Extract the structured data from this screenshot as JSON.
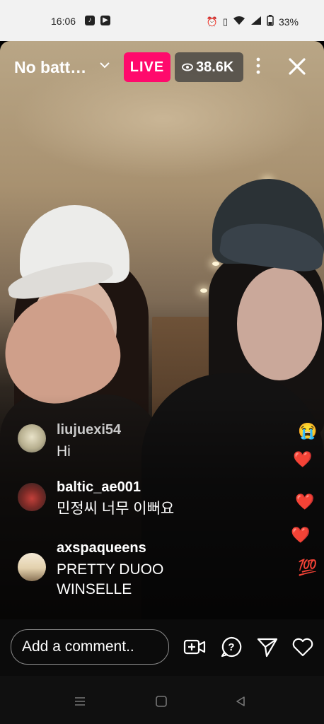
{
  "status_bar": {
    "time": "16:06",
    "battery": "33%",
    "left_icons": [
      "tiktok-icon",
      "youtube-icon"
    ],
    "right_icons": [
      "alarm-icon",
      "vibrate-icon",
      "wifi-icon",
      "signal-icon",
      "battery-icon"
    ]
  },
  "stream": {
    "title": "No batt…",
    "live_label": "LIVE",
    "viewers": "38.6K",
    "colors": {
      "live": "#ff0a6c"
    }
  },
  "comments": [
    {
      "user": "liujuexi54",
      "text": "Hi"
    },
    {
      "user": "baltic_ae001",
      "text": "민정씨 너무 이뻐요"
    },
    {
      "user": "axspaqueens",
      "text_lines": [
        "PRETTY DUOO",
        "WINSELLE"
      ]
    }
  ],
  "reactions": [
    "😭",
    "❤️",
    "❤️",
    "❤️",
    "💯"
  ],
  "bottom_bar": {
    "comment_placeholder": "Add a comment..",
    "icons": [
      "add-video-guest-icon",
      "question-icon",
      "send-icon",
      "heart-icon"
    ]
  },
  "nav_bar": {
    "icons": [
      "recents-icon",
      "home-icon",
      "back-icon"
    ]
  }
}
